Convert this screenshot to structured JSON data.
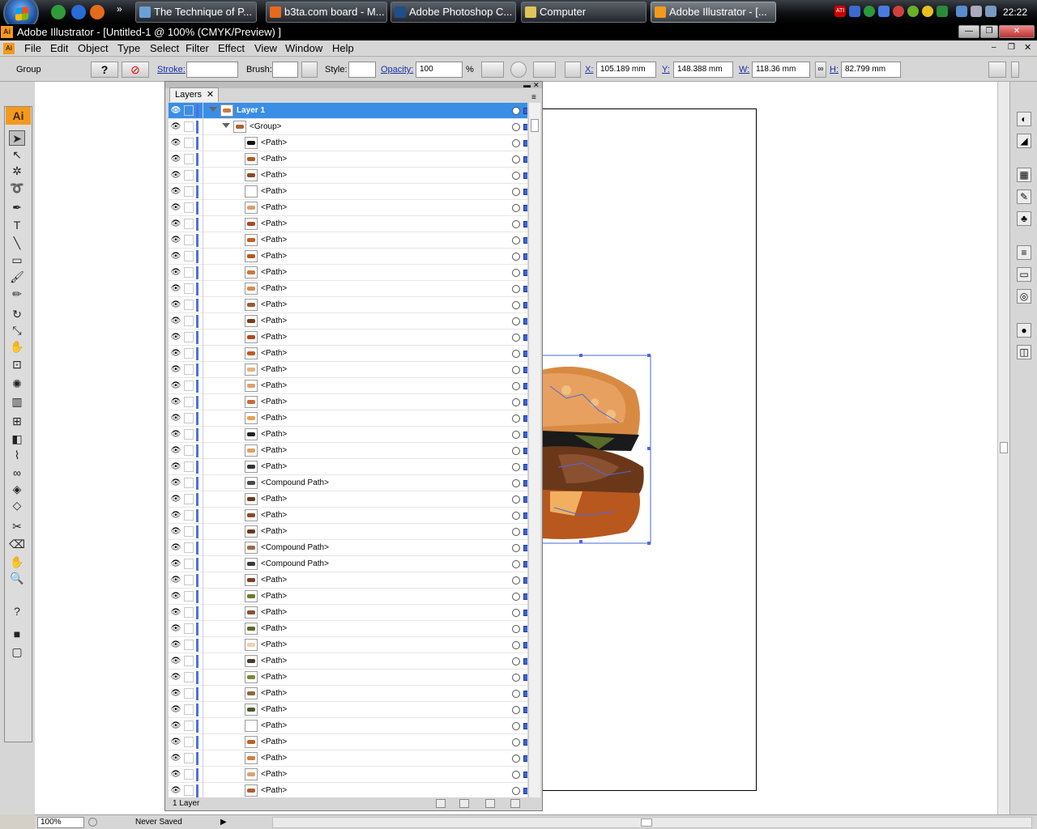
{
  "taskbar": {
    "tasks": [
      {
        "label": "The Technique of P...",
        "color": "#6aa0d8"
      },
      {
        "label": "b3ta.com board - M...",
        "color": "#e56a1c"
      },
      {
        "label": "Adobe Photoshop C...",
        "color": "#1f4f8a"
      },
      {
        "label": "Computer",
        "color": "#e2c35a"
      },
      {
        "label": "Adobe Illustrator - [...",
        "color": "#f39a1e"
      }
    ],
    "clock": "22:22"
  },
  "window": {
    "title": "Adobe Illustrator - [Untitled-1 @ 100% (CMYK/Preview) ]",
    "app_icon": "Ai"
  },
  "menu": [
    "File",
    "Edit",
    "Object",
    "Type",
    "Select",
    "Filter",
    "Effect",
    "View",
    "Window",
    "Help"
  ],
  "control": {
    "selection": "Group",
    "stroke_label": "Stroke:",
    "brush_label": "Brush:",
    "style_label": "Style:",
    "opacity_label": "Opacity:",
    "opacity_value": "100",
    "opacity_unit": "%",
    "x_label": "X:",
    "x_value": "105.189 mm",
    "y_label": "Y:",
    "y_value": "148.388 mm",
    "w_label": "W:",
    "w_value": "118.36 mm",
    "h_label": "H:",
    "h_value": "82.799 mm"
  },
  "toolbox": {
    "logo": "Ai",
    "tools": [
      "selection-tool",
      "direct-selection-tool",
      "magic-wand-tool",
      "lasso-tool",
      "pen-tool",
      "type-tool",
      "line-tool",
      "rectangle-tool",
      "paintbrush-tool",
      "pencil-tool",
      "rotate-tool",
      "scale-tool",
      "warp-tool",
      "free-transform-tool",
      "symbol-sprayer-tool",
      "column-graph-tool",
      "mesh-tool",
      "gradient-tool",
      "eyedropper-tool",
      "blend-tool",
      "live-paint-tool",
      "live-paint-selection-tool",
      "slice-tool",
      "eraser-tool",
      "hand-tool",
      "zoom-tool"
    ]
  },
  "layers_panel": {
    "tab": "Layers",
    "layer_name": "Layer 1",
    "group_name": "<Group>",
    "items": [
      {
        "name": "<Path>",
        "color": "#111111"
      },
      {
        "name": "<Path>",
        "color": "#b05a2a"
      },
      {
        "name": "<Path>",
        "color": "#8a4a22"
      },
      {
        "name": "<Path>",
        "color": "#ffffff"
      },
      {
        "name": "<Path>",
        "color": "#d8a070"
      },
      {
        "name": "<Path>",
        "color": "#a84a28"
      },
      {
        "name": "<Path>",
        "color": "#c4601c"
      },
      {
        "name": "<Path>",
        "color": "#b8581e"
      },
      {
        "name": "<Path>",
        "color": "#c87a40"
      },
      {
        "name": "<Path>",
        "color": "#d88a50"
      },
      {
        "name": "<Path>",
        "color": "#9a5a30"
      },
      {
        "name": "<Path>",
        "color": "#7a3a18"
      },
      {
        "name": "<Path>",
        "color": "#b04a20"
      },
      {
        "name": "<Path>",
        "color": "#c05a22"
      },
      {
        "name": "<Path>",
        "color": "#e8b080"
      },
      {
        "name": "<Path>",
        "color": "#e0a070"
      },
      {
        "name": "<Path>",
        "color": "#c86a3a"
      },
      {
        "name": "<Path>",
        "color": "#e8a050"
      },
      {
        "name": "<Path>",
        "color": "#222222"
      },
      {
        "name": "<Path>",
        "color": "#e0a060"
      },
      {
        "name": "<Path>",
        "color": "#333333"
      },
      {
        "name": "<Compound Path>",
        "color": "#4a4a4a"
      },
      {
        "name": "<Path>",
        "color": "#6a3a20"
      },
      {
        "name": "<Path>",
        "color": "#8a4a2a"
      },
      {
        "name": "<Path>",
        "color": "#6a3818"
      },
      {
        "name": "<Compound Path>",
        "color": "#9a6a4a"
      },
      {
        "name": "<Compound Path>",
        "color": "#3a3a3a"
      },
      {
        "name": "<Path>",
        "color": "#7a4020"
      },
      {
        "name": "<Path>",
        "color": "#6a7a2a"
      },
      {
        "name": "<Path>",
        "color": "#8a5030"
      },
      {
        "name": "<Path>",
        "color": "#5a6a2a"
      },
      {
        "name": "<Path>",
        "color": "#f0d0b0"
      },
      {
        "name": "<Path>",
        "color": "#4a3a2a"
      },
      {
        "name": "<Path>",
        "color": "#7a8a3a"
      },
      {
        "name": "<Path>",
        "color": "#8a6a3a"
      },
      {
        "name": "<Path>",
        "color": "#4a5a2a"
      },
      {
        "name": "<Path>",
        "color": "#ffffff"
      },
      {
        "name": "<Path>",
        "color": "#c0601a"
      },
      {
        "name": "<Path>",
        "color": "#d08040"
      },
      {
        "name": "<Path>",
        "color": "#e0a070"
      },
      {
        "name": "<Path>",
        "color": "#b06030"
      }
    ],
    "footer_count": "1 Layer"
  },
  "status": {
    "zoom": "100%",
    "save_state": "Never Saved"
  }
}
